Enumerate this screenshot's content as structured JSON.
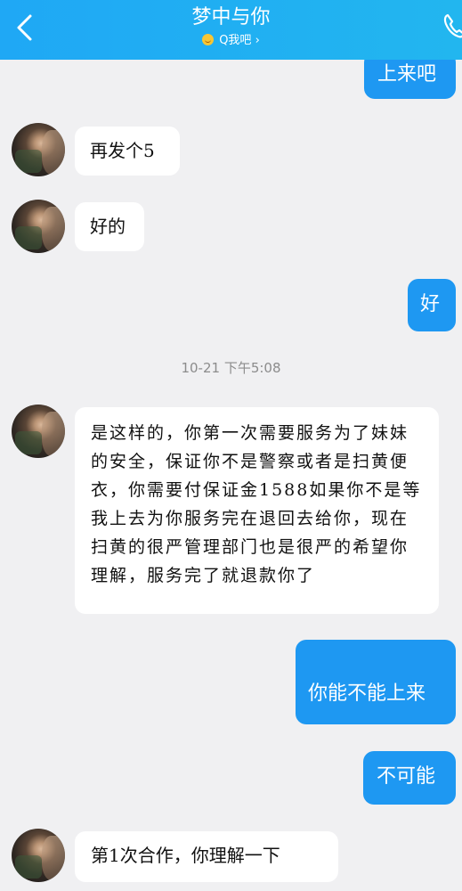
{
  "header": {
    "title": "梦中与你",
    "subtitle": "Q我吧",
    "subtitle_arrow": "›",
    "icons": [
      "back-icon",
      "smile-icon",
      "phone-icon"
    ]
  },
  "messages": [
    {
      "side": "right",
      "text": "上来吧"
    },
    {
      "side": "left",
      "text": "再发个5"
    },
    {
      "side": "left",
      "text": "好的"
    },
    {
      "side": "right",
      "text": "好"
    },
    {
      "side": "left",
      "text": "是这样的，你第一次需要服务为了妹妹的安全，保证你不是警察或者是扫黄便衣，你需要付保证金1588如果你不是等我上去为你服务完在退回去给你，现在扫黄的很严管理部门也是很严的希望你理解，服务完了就退款你了"
    },
    {
      "side": "right",
      "text": "你能不能上来"
    },
    {
      "side": "right",
      "text": "不可能"
    },
    {
      "side": "left",
      "text": "第1次合作，你理解一下"
    }
  ],
  "timestamp": "10-21 下午5:08",
  "colors": {
    "header_bg": "#1fa8f5",
    "outgoing_bubble": "#1e98f2",
    "incoming_bubble": "#ffffff",
    "chat_bg": "#f0f0f2"
  }
}
